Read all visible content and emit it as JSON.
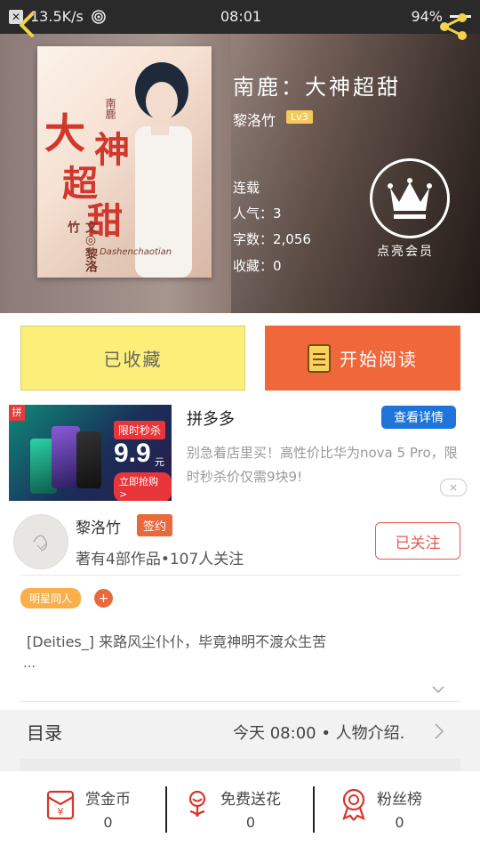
{
  "status_bar": {
    "speed": "13.5K/s",
    "time": "08:01",
    "battery": "94%"
  },
  "book": {
    "title": "南鹿：大神超甜",
    "author": "黎洛竹",
    "author_level": "Lv3",
    "status": "连载",
    "popularity": "人气：3",
    "word_count": "字数：2,056",
    "favorites": "收藏：0",
    "vip_label": "点亮会员"
  },
  "cover": {
    "title_chars": [
      "大",
      "超",
      "神",
      "甜"
    ],
    "subtitle": "南鹿",
    "author_text": "文◎黎洛竹",
    "pinyin": "Dashenchaotian"
  },
  "actions": {
    "collected": "已收藏",
    "start_reading": "开始阅读"
  },
  "ad": {
    "brand": "拼多多",
    "details_button": "查看详情",
    "description": "别急着店里买！高性价比华为nova 5 Pro，限时秒杀价仅需9块9!",
    "image_tag": "限时秒杀",
    "image_price": "9.9",
    "image_price_unit": "元",
    "image_cta": "立即抢购 >",
    "logo_text": "拼",
    "close_icon": "×"
  },
  "author_card": {
    "name": "黎洛竹",
    "badge": "签约",
    "stats": "著有4部作品•107人关注",
    "follow_button": "已关注"
  },
  "tags": {
    "tag1": "明星同人",
    "add": "+"
  },
  "synopsis": {
    "text": "[Deities_] 来路风尘仆仆，毕竟神明不渡众生苦",
    "ellipsis": "…"
  },
  "toc": {
    "label": "目录",
    "latest": "今天 08:00 • 人物介绍."
  },
  "bottom_bar": [
    {
      "label": "赏金币",
      "count": "0"
    },
    {
      "label": "免费送花",
      "count": "0"
    },
    {
      "label": "粉丝榜",
      "count": "0"
    }
  ]
}
